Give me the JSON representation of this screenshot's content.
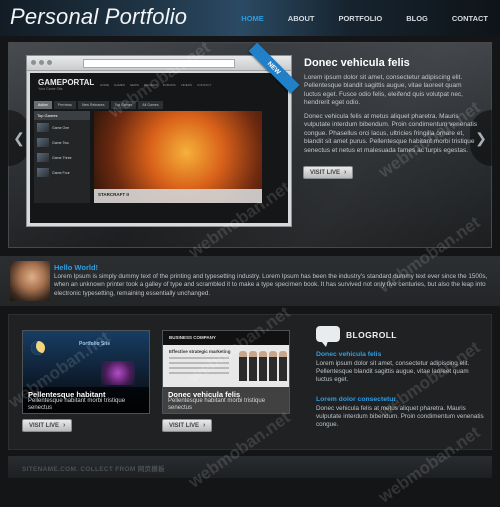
{
  "site": {
    "title": "Personal Portfolio"
  },
  "nav": [
    {
      "label": "HOME",
      "active": true
    },
    {
      "label": "ABOUT"
    },
    {
      "label": "PORTFOLIO"
    },
    {
      "label": "BLOG"
    },
    {
      "label": "CONTACT"
    }
  ],
  "slider": {
    "ribbon": "NEW",
    "title": "Donec vehicula felis",
    "paragraphs": [
      "Lorem ipsum dolor sit amet, consectetur adipiscing elit. Pellentesque blandit sagittis augue, vitae laoreet quam luctus eget. Fusce odio felis, eleifend quis volutpat nec, hendrerit eget odio.",
      "Donec vehicula felis at metus aliquet pharetra. Mauris vulputate interdum bibendum. Proin condimentum venenatis congue. Phasellus orci lacus, ultricies fringilla ornare et, blandit sit amet purus. Pellentesque habitant morbi tristique senectus et netus et malesuada fames ac turpis egestas."
    ],
    "button": "VISIT LIVE",
    "screenshot": {
      "logo": "GAMEPORTAL",
      "tagline": "Your Game Site",
      "nav": [
        "HOME",
        "GAMES",
        "NEWS",
        "REVIEWS",
        "FORUMS",
        "VIDEOS",
        "CONTACT"
      ],
      "tabs": [
        "Action",
        "Previews",
        "New Releases",
        "Top Games",
        "All Games"
      ],
      "side_title": "Top Games",
      "games": [
        "Game One",
        "Game Two",
        "Game Three",
        "Game Four"
      ],
      "feature_label": "STARCRAFT II"
    }
  },
  "hello": {
    "title": "Hello World!",
    "text": "Lorem Ipsum is simply dummy text of the printing and typesetting industry. Lorem Ipsum has been the industry's standard dummy text ever since the 1500s, when an unknown printer took a galley of type and scrambled it to make a type specimen book. It has survived not only five centuries, but also the leap into electronic typesetting, remaining essentially unchanged."
  },
  "portfolio": [
    {
      "title": "Pellentesque habitant",
      "text": "Pellentesque habitant morbi tristique senectus",
      "button": "VISIT LIVE",
      "logo": "Portfolio Site"
    },
    {
      "title": "Donec vehicula felis",
      "text": "Pellentesque habitant morbi tristique senectus",
      "button": "VISIT LIVE",
      "brand": "BUSINESS COMPANY",
      "headline": "Effective strategic marketing"
    }
  ],
  "blogroll": {
    "title": "BLOGROLL",
    "posts": [
      {
        "title": "Donec vehicula felis",
        "text": "Lorem ipsum dolor sit amet, consectetur adipiscing elit. Pellentesque blandit sagittis augue, vitae laoreet quam luctus eget."
      },
      {
        "title": "Lorem dolor consectetur",
        "text": "Donec vehicula felis at metus aliquet pharetra. Mauris vulputate interdum bibendum. Proin condimentum venenatis congue."
      }
    ]
  },
  "footer": {
    "text": "SITENAME.COM. COLLECT FROM 网页模板"
  },
  "watermark": "webmoban.net",
  "colors": {
    "accent": "#2b9ddf",
    "background": "#141516"
  }
}
